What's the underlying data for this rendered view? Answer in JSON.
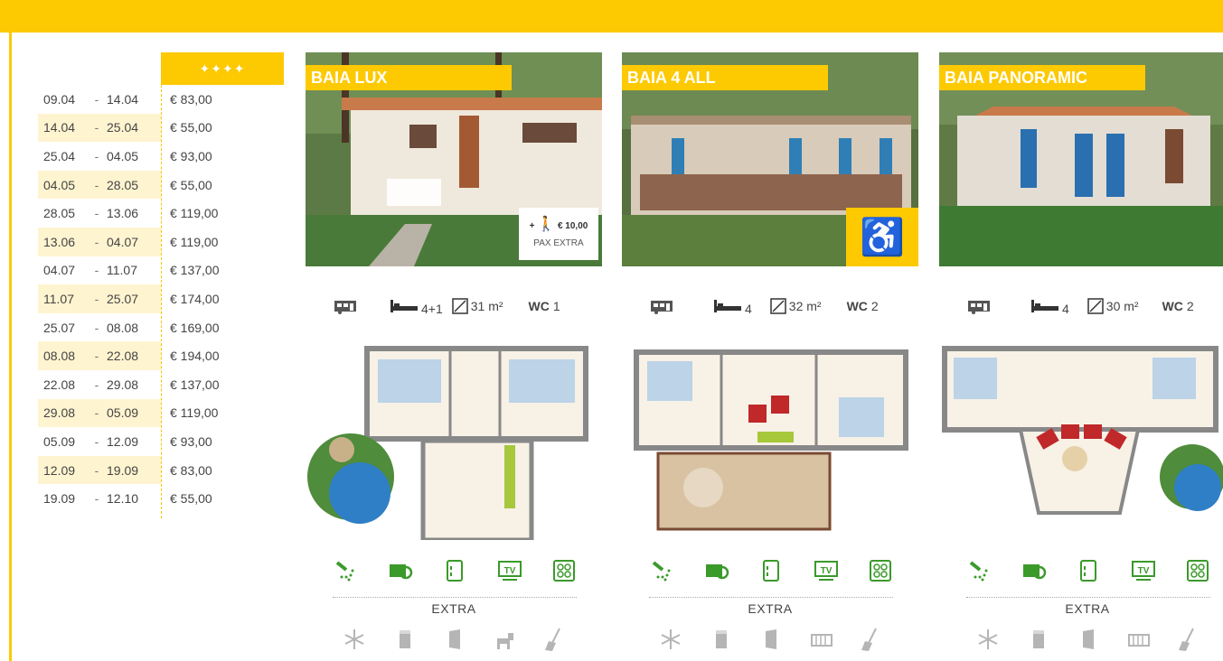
{
  "price_table": {
    "header_stars": "✦✦✦✦",
    "rows": [
      {
        "from": "09.04",
        "to": "14.04",
        "price": "€ 83,00"
      },
      {
        "from": "14.04",
        "to": "25.04",
        "price": "€ 55,00"
      },
      {
        "from": "25.04",
        "to": "04.05",
        "price": "€ 93,00"
      },
      {
        "from": "04.05",
        "to": "28.05",
        "price": "€ 55,00"
      },
      {
        "from": "28.05",
        "to": "13.06",
        "price": "€ 119,00"
      },
      {
        "from": "13.06",
        "to": "04.07",
        "price": "€ 119,00"
      },
      {
        "from": "04.07",
        "to": "11.07",
        "price": "€ 137,00"
      },
      {
        "from": "11.07",
        "to": "25.07",
        "price": "€ 174,00"
      },
      {
        "from": "25.07",
        "to": "08.08",
        "price": "€ 169,00"
      },
      {
        "from": "08.08",
        "to": "22.08",
        "price": "€ 194,00"
      },
      {
        "from": "22.08",
        "to": "29.08",
        "price": "€ 137,00"
      },
      {
        "from": "29.08",
        "to": "05.09",
        "price": "€ 119,00"
      },
      {
        "from": "05.09",
        "to": "12.09",
        "price": "€ 93,00"
      },
      {
        "from": "12.09",
        "to": "19.09",
        "price": "€ 83,00"
      },
      {
        "from": "19.09",
        "to": "12.10",
        "price": "€ 55,00"
      }
    ],
    "separator": "-"
  },
  "units": [
    {
      "name": "BAIA LUX",
      "beds": "4+1",
      "area": "31 m²",
      "wc_label": "WC",
      "wc": "1",
      "badge": {
        "type": "pax",
        "amount": "€ 10,00",
        "plus": "+",
        "text": "PAX EXTRA"
      },
      "extras": [
        "snowflake-icon",
        "bed-sheet-icon",
        "towel-icon",
        "dog-icon",
        "broom-icon"
      ]
    },
    {
      "name": "BAIA 4 ALL",
      "beds": "4",
      "area": "32 m²",
      "wc_label": "WC",
      "wc": "2",
      "badge": {
        "type": "wheelchair"
      },
      "extras": [
        "snowflake-icon",
        "bed-sheet-icon",
        "towel-icon",
        "crib-icon",
        "broom-icon"
      ]
    },
    {
      "name": "BAIA PANORAMIC",
      "beds": "4",
      "area": "30 m²",
      "wc_label": "WC",
      "wc": "2",
      "badge": {
        "type": "none"
      },
      "extras": [
        "snowflake-icon",
        "bed-sheet-icon",
        "towel-icon",
        "crib-icon",
        "broom-icon"
      ]
    }
  ],
  "features": [
    "shower-icon",
    "grill-icon",
    "fridge-icon",
    "tv-icon",
    "stove-icon"
  ],
  "extra_label": "EXTRA",
  "colors": {
    "accent": "#FDC900",
    "shade": "#FFF4D0",
    "feature_green": "#3a9a2a",
    "extra_gray": "#b5b5b5"
  }
}
